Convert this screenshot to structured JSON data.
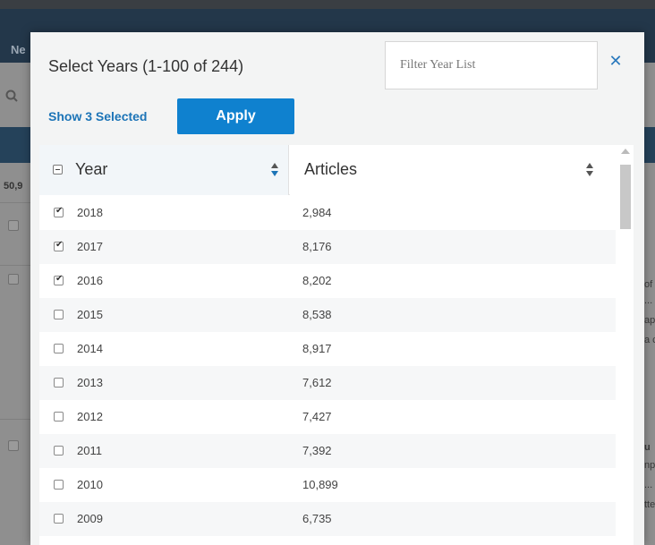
{
  "background": {
    "nav_fragment": "Ne",
    "count_fragment": "50,9",
    "right_fragments": [
      "of",
      "...",
      "ap",
      "a c",
      "u",
      "np",
      "...",
      "tte"
    ]
  },
  "modal": {
    "title": "Select Years (1-100 of 244)",
    "filter_placeholder": "Filter Year List",
    "show_selected_label": "Show 3 Selected",
    "apply_label": "Apply",
    "close_symbol": "✕"
  },
  "table": {
    "columns": [
      "Year",
      "Articles"
    ],
    "sort": {
      "column": "Year",
      "direction": "descending"
    },
    "rows": [
      {
        "year": "2018",
        "articles": "2,984",
        "checked": true
      },
      {
        "year": "2017",
        "articles": "8,176",
        "checked": true
      },
      {
        "year": "2016",
        "articles": "8,202",
        "checked": true
      },
      {
        "year": "2015",
        "articles": "8,538",
        "checked": false
      },
      {
        "year": "2014",
        "articles": "8,917",
        "checked": false
      },
      {
        "year": "2013",
        "articles": "7,612",
        "checked": false
      },
      {
        "year": "2012",
        "articles": "7,427",
        "checked": false
      },
      {
        "year": "2011",
        "articles": "7,392",
        "checked": false
      },
      {
        "year": "2010",
        "articles": "10,899",
        "checked": false
      },
      {
        "year": "2009",
        "articles": "6,735",
        "checked": false
      }
    ]
  },
  "colors": {
    "accent": "#1c74b7",
    "apply_button": "#0f81cf",
    "navbar": "#23374a"
  }
}
